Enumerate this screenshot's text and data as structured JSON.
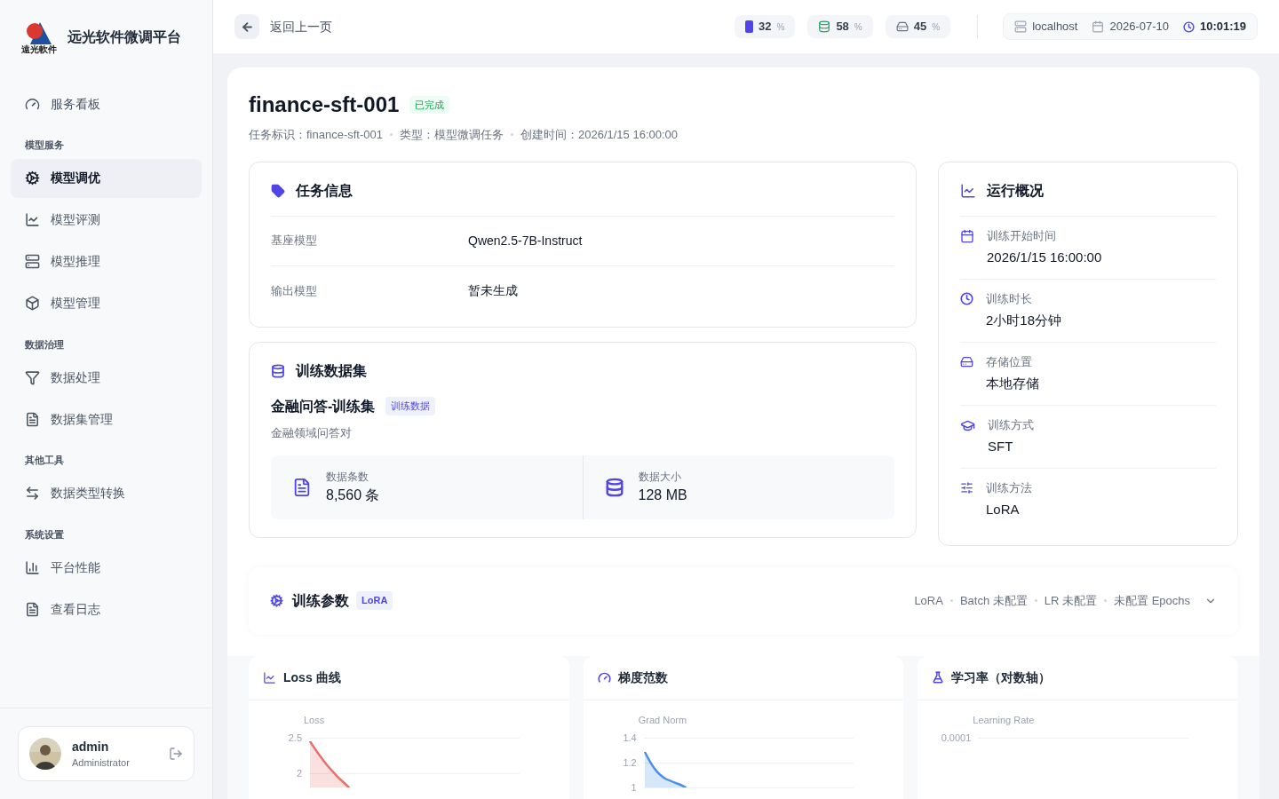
{
  "sidebar": {
    "brand": "远光软件微调平台",
    "logo_caption": "遠光軟件",
    "groups": [
      {
        "items": [
          {
            "label": "服务看板",
            "selected": false
          }
        ]
      },
      {
        "title": "模型服务",
        "items": [
          {
            "label": "模型调优",
            "selected": true
          },
          {
            "label": "模型评测",
            "selected": false
          },
          {
            "label": "模型推理",
            "selected": false
          },
          {
            "label": "模型管理",
            "selected": false
          }
        ]
      },
      {
        "title": "数据治理",
        "items": [
          {
            "label": "数据处理",
            "selected": false
          },
          {
            "label": "数据集管理",
            "selected": false
          }
        ]
      },
      {
        "title": "其他工具",
        "items": [
          {
            "label": "数据类型转换",
            "selected": false
          }
        ]
      },
      {
        "title": "系统设置",
        "items": [
          {
            "label": "平台性能",
            "selected": false
          },
          {
            "label": "查看日志",
            "selected": false
          }
        ]
      }
    ],
    "user": {
      "name": "admin",
      "role": "Administrator"
    }
  },
  "header": {
    "back_label": "返回上一页",
    "stats": [
      {
        "kind": "gpu",
        "value": "32",
        "unit": "%"
      },
      {
        "kind": "memory",
        "value": "58",
        "unit": "%"
      },
      {
        "kind": "disk",
        "value": "45",
        "unit": "%"
      }
    ],
    "host": "localhost",
    "date": "2026-07-10",
    "time": "10:01:19"
  },
  "task": {
    "title": "finance-sft-001",
    "status": "已完成",
    "meta": [
      "任务标识：finance-sft-001",
      "类型：模型微调任务",
      "创建时间：2026/1/15 16:00:00"
    ]
  },
  "info_card": {
    "title": "任务信息",
    "rows": [
      {
        "label": "基座模型",
        "value": "Qwen2.5-7B-Instruct"
      },
      {
        "label": "输出模型",
        "value": "暂未生成"
      }
    ]
  },
  "dataset_card": {
    "title": "训练数据集",
    "name": "金融问答-训练集",
    "tag": "训练数据",
    "description": "金融领域问答对",
    "stats": [
      {
        "kind": "count",
        "label": "数据条数",
        "value": "8,560 条"
      },
      {
        "kind": "size",
        "label": "数据大小",
        "value": "128 MB"
      }
    ]
  },
  "overview": {
    "title": "运行概况",
    "items": [
      {
        "kind": "start",
        "label": "训练开始时间",
        "value": "2026/1/15 16:00:00"
      },
      {
        "kind": "duration",
        "label": "训练时长",
        "value": "2小时18分钟"
      },
      {
        "kind": "storage",
        "label": "存储位置",
        "value": "本地存储"
      },
      {
        "kind": "mode",
        "label": "训练方式",
        "value": "SFT"
      },
      {
        "kind": "method",
        "label": "训练方法",
        "value": "LoRA"
      }
    ]
  },
  "params": {
    "title": "训练参数",
    "badge": "LoRA",
    "summary": [
      "LoRA",
      "Batch 未配置",
      "LR 未配置",
      "未配置 Epochs"
    ],
    "expanded": false
  },
  "charts": [
    {
      "kind": "loss",
      "title": "Loss 曲线",
      "axis_label": "Loss",
      "ticks": [
        "2.5",
        "2"
      ],
      "color": "#e8706a"
    },
    {
      "kind": "grad",
      "title": "梯度范数",
      "axis_label": "Grad Norm",
      "ticks": [
        "1.4",
        "1.2",
        "1"
      ],
      "color": "#4a90e8"
    },
    {
      "kind": "lr",
      "title": "学习率（对数轴）",
      "axis_label": "Learning Rate",
      "ticks": [
        "0.0001"
      ]
    }
  ]
}
